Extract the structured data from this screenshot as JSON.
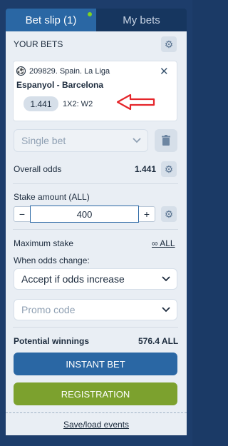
{
  "tabs": {
    "bet_slip": "Bet slip (1)",
    "my_bets": "My bets"
  },
  "your_bets": {
    "title": "YOUR BETS"
  },
  "bet": {
    "event": "209829. Spain. La Liga",
    "teams": "Espanyol - Barcelona",
    "odds": "1.441",
    "outcome": "1X2: W2"
  },
  "bet_type": {
    "selected": "Single bet"
  },
  "overall_odds": {
    "label": "Overall odds",
    "value": "1.441"
  },
  "stake": {
    "label": "Stake amount (ALL)",
    "minus": "−",
    "plus": "+",
    "value": "400"
  },
  "max_stake": {
    "label": "Maximum stake",
    "link": "∞ ALL"
  },
  "odds_change": {
    "label": "When odds change:",
    "selected": "Accept if odds increase"
  },
  "promo": {
    "placeholder": "Promo code"
  },
  "winnings": {
    "label": "Potential winnings",
    "value": "576.4 ALL"
  },
  "buttons": {
    "instant": "INSTANT BET",
    "registration": "REGISTRATION"
  },
  "footer": {
    "save_load": "Save/load events"
  },
  "colors": {
    "primary": "#2a67a4",
    "green": "#7ca12e",
    "bg": "#1d3d6b",
    "arrow": "#e5252a"
  }
}
